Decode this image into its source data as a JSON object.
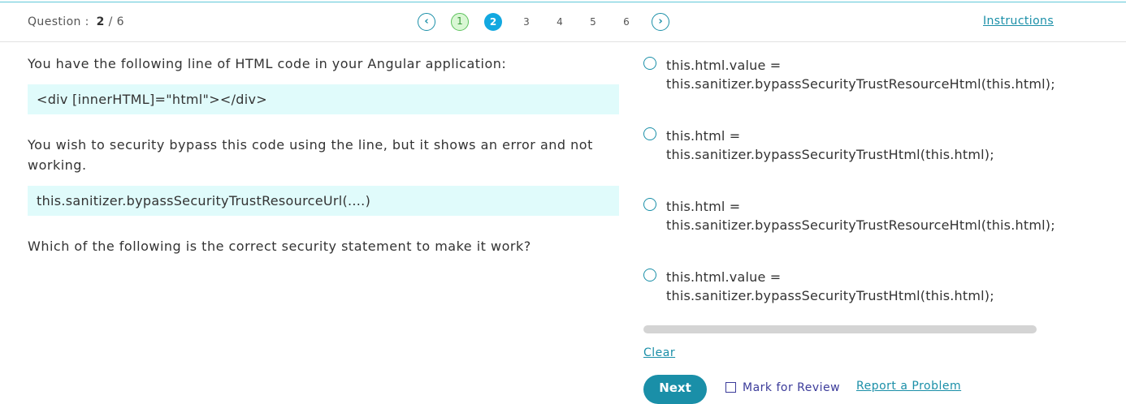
{
  "header": {
    "question_label": "Question :",
    "question_current": "2",
    "question_total": "/ 6",
    "prev_icon": "chevron-left-icon",
    "next_icon": "chevron-right-icon",
    "pages": [
      "1",
      "2",
      "3",
      "4",
      "5",
      "6"
    ],
    "answered_page": "1",
    "current_page": "2",
    "instructions_label": "Instructions"
  },
  "question": {
    "intro": "You have the following line of HTML code in your Angular application:",
    "code1": "<div [innerHTML]=\"html\"></div>",
    "problem": "You wish to security bypass this code using the line, but it shows an error and not working.",
    "code2": "this.sanitizer.bypassSecurityTrustResourceUrl(....)",
    "prompt": "Which of the following is the correct security statement to make it work?"
  },
  "options": [
    {
      "line1": "this.html.value =",
      "line2": "this.sanitizer.bypassSecurityTrustResourceHtml(this.html);"
    },
    {
      "line1": "this.html =",
      "line2": "this.sanitizer.bypassSecurityTrustHtml(this.html);"
    },
    {
      "line1": "this.html =",
      "line2": "this.sanitizer.bypassSecurityTrustResourceHtml(this.html);"
    },
    {
      "line1": "this.html.value =",
      "line2": "this.sanitizer.bypassSecurityTrustHtml(this.html);"
    }
  ],
  "footer": {
    "clear_label": "Clear",
    "next_label": "Next",
    "mark_label": "Mark for Review",
    "report_label": "Report a Problem"
  },
  "colors": {
    "accent": "#1a8fa8",
    "current_page": "#12a8e0",
    "answered_page": "#5cc25c",
    "code_bg": "#e0fbfb"
  }
}
